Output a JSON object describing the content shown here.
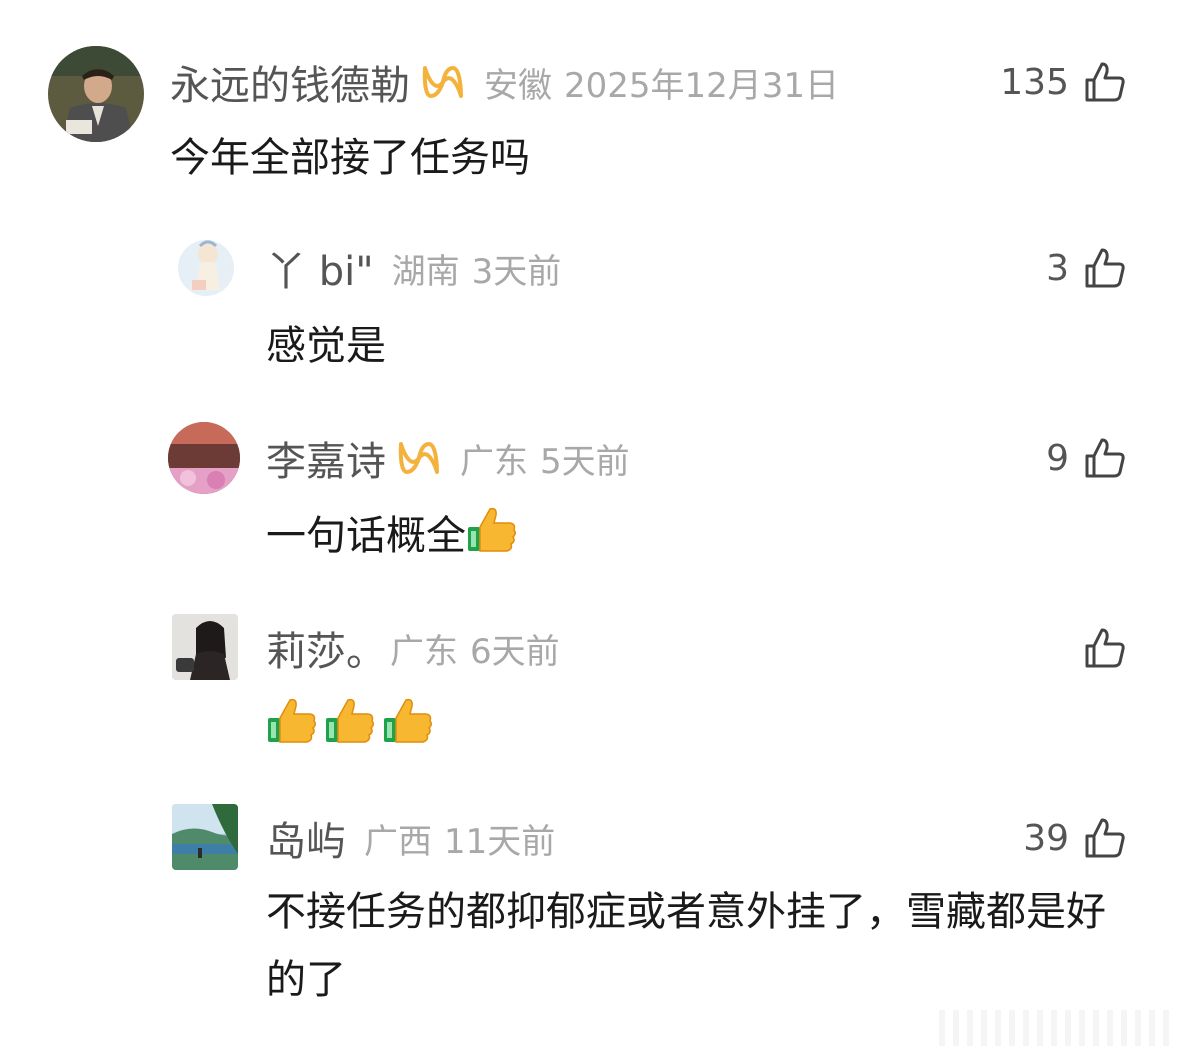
{
  "comments": [
    {
      "username": "永远的钱德勒",
      "vip": true,
      "location": "安徽",
      "time": "2025年12月31日",
      "likes": "135",
      "text": "今年全部接了任务吗",
      "emoji_count": 0
    },
    {
      "username": "丫 bi\"",
      "vip": false,
      "location": "湖南",
      "time": "3天前",
      "likes": "3",
      "text": "感觉是",
      "emoji_count": 0
    },
    {
      "username": "李嘉诗",
      "vip": true,
      "location": "广东",
      "time": "5天前",
      "likes": "9",
      "text": "一句话概全",
      "emoji_count": 1
    },
    {
      "username": "莉莎。",
      "vip": false,
      "location": "广东",
      "time": "6天前",
      "likes": "",
      "text": "",
      "emoji_count": 3
    },
    {
      "username": "岛屿",
      "vip": false,
      "location": "广西",
      "time": "11天前",
      "likes": "39",
      "text": "不接任务的都抑郁症或者意外挂了，雪藏都是好的了",
      "emoji_count": 0
    }
  ],
  "icons": {
    "like": "thumbs-up-outline-icon",
    "vip": "vip-loop-badge-icon",
    "emoji": "thumbs-up-emoji"
  },
  "colors": {
    "username": "#555555",
    "meta": "#a8a8a8",
    "vip": "#f4b23c"
  }
}
